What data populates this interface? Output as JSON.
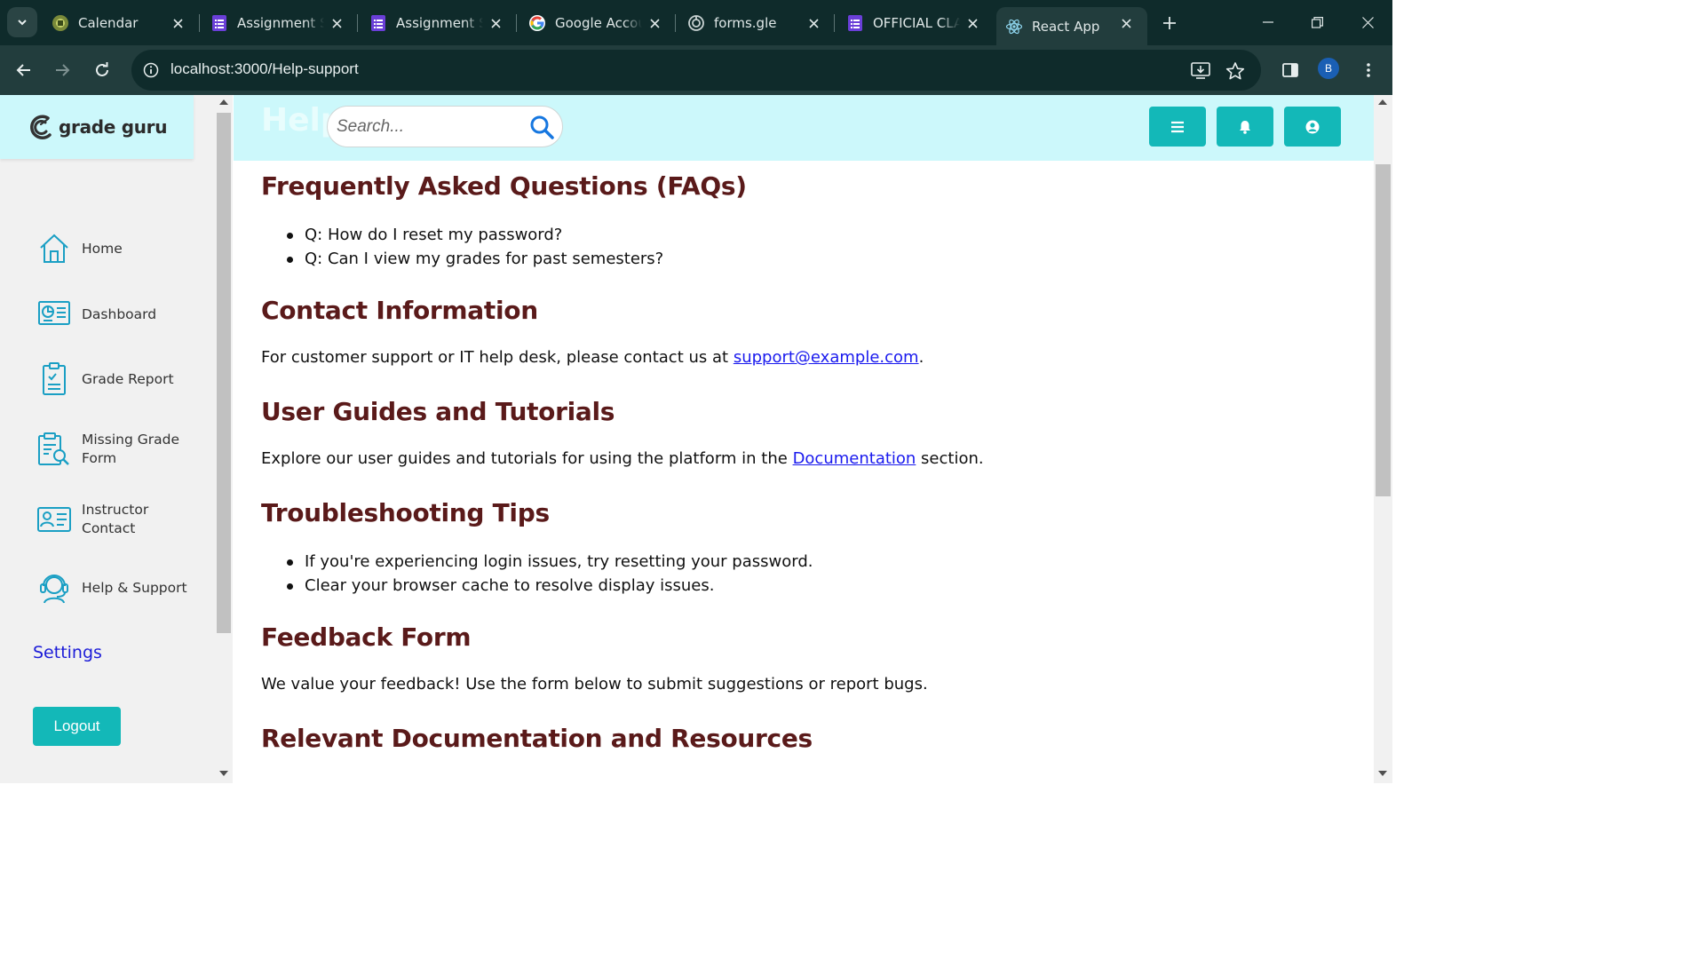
{
  "browser": {
    "tabs": [
      {
        "title": "Calendar",
        "icon": "calendar-favicon"
      },
      {
        "title": "Assignment Submission",
        "icon": "forms-favicon"
      },
      {
        "title": "Assignment Submission",
        "icon": "forms-favicon"
      },
      {
        "title": "Google Account",
        "icon": "google-favicon"
      },
      {
        "title": "forms.gle",
        "icon": "globe-favicon"
      },
      {
        "title": "OFFICIAL CLASS",
        "icon": "forms-favicon"
      },
      {
        "title": "React App",
        "icon": "react-favicon",
        "active": true
      }
    ],
    "url": "localhost:3000/Help-support",
    "profile_initial": "B"
  },
  "sidebar": {
    "logo_text": "grade guru",
    "items": [
      {
        "label": "Home",
        "icon": "home-icon"
      },
      {
        "label": "Dashboard",
        "icon": "dashboard-icon"
      },
      {
        "label": "Grade Report",
        "icon": "grade-report-icon"
      },
      {
        "label": "Missing Grade Form",
        "icon": "missing-grade-form-icon"
      },
      {
        "label": "Instructor Contact",
        "icon": "instructor-contact-icon"
      },
      {
        "label": "Help & Support",
        "icon": "help-support-icon"
      }
    ],
    "settings_label": "Settings",
    "logout_label": "Logout"
  },
  "header": {
    "bg_title": "Help",
    "search_placeholder": "Search...",
    "buttons": [
      "menu-icon",
      "bell-icon",
      "user-icon"
    ]
  },
  "main": {
    "faq": {
      "title": "Frequently Asked Questions (FAQs)",
      "items": [
        "Q: How do I reset my password?",
        "Q: Can I view my grades for past semesters?"
      ]
    },
    "contact": {
      "title": "Contact Information",
      "text_before": "For customer support or IT help desk, please contact us at ",
      "link": "support@example.com",
      "text_after": "."
    },
    "guides": {
      "title": "User Guides and Tutorials",
      "text_before": "Explore our user guides and tutorials for using the platform in the ",
      "link": "Documentation",
      "text_after": " section."
    },
    "troubleshooting": {
      "title": "Troubleshooting Tips",
      "items": [
        "If you're experiencing login issues, try resetting your password.",
        "Clear your browser cache to resolve display issues."
      ]
    },
    "feedback": {
      "title": "Feedback Form",
      "text": "We value your feedback! Use the form below to submit suggestions or report bugs."
    },
    "resources": {
      "title": "Relevant Documentation and Resources"
    }
  },
  "colors": {
    "accent": "#13b8b8",
    "header_bg": "#ccf8fb",
    "heading": "#5a1a1a",
    "link": "#1a1aee",
    "chrome_dark": "#0f2b2b",
    "chrome_toolbar": "#223d3d"
  }
}
